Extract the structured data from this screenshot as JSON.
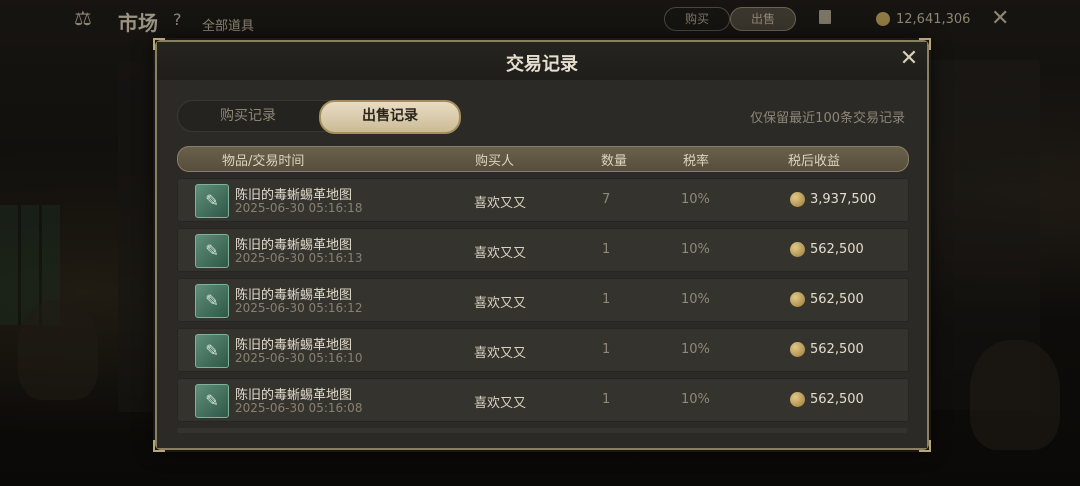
{
  "topbar": {
    "scale_icon": "⚖",
    "title": "市场",
    "help": "?",
    "all_items": "全部道具",
    "tab_buy": "购买",
    "tab_sell": "出售",
    "currency": "12,641,306",
    "close": "✕"
  },
  "modal": {
    "title": "交易记录",
    "close": "✕",
    "tabs": {
      "buy": "购买记录",
      "sell": "出售记录"
    },
    "note": "仅保留最近100条交易记录",
    "headers": {
      "item_time": "物品/交易时间",
      "buyer": "购买人",
      "quantity": "数量",
      "tax_rate": "税率",
      "income": "税后收益"
    },
    "rows": [
      {
        "name": "陈旧的毒蜥蜴革地图",
        "time": "2025-06-30 05:16:18",
        "buyer": "喜欢又又",
        "quantity": "7",
        "tax": "10%",
        "income": "3,937,500"
      },
      {
        "name": "陈旧的毒蜥蜴革地图",
        "time": "2025-06-30 05:16:13",
        "buyer": "喜欢又又",
        "quantity": "1",
        "tax": "10%",
        "income": "562,500"
      },
      {
        "name": "陈旧的毒蜥蜴革地图",
        "time": "2025-06-30 05:16:12",
        "buyer": "喜欢又又",
        "quantity": "1",
        "tax": "10%",
        "income": "562,500"
      },
      {
        "name": "陈旧的毒蜥蜴革地图",
        "time": "2025-06-30 05:16:10",
        "buyer": "喜欢又又",
        "quantity": "1",
        "tax": "10%",
        "income": "562,500"
      },
      {
        "name": "陈旧的毒蜥蜴革地图",
        "time": "2025-06-30 05:16:08",
        "buyer": "喜欢又又",
        "quantity": "1",
        "tax": "10%",
        "income": "562,500"
      }
    ]
  },
  "icons": {
    "item": "scroll-map-icon",
    "coin": "gold-coin-icon"
  },
  "colors": {
    "accent_gold": "#a48e5c",
    "panel": "#2d2b27",
    "item_icon": "#4f8572"
  }
}
